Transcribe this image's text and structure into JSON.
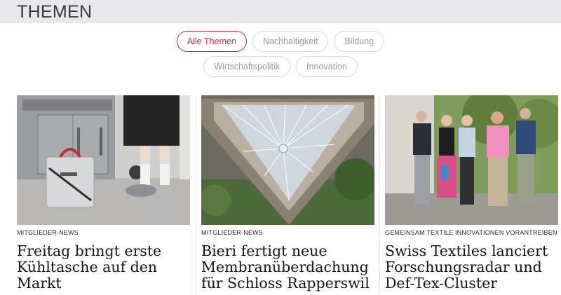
{
  "header": {
    "title": "THEMEN"
  },
  "filters": {
    "row1": [
      {
        "label": "Alle Themen",
        "active": true
      },
      {
        "label": "Nachhaltigkeit",
        "active": false
      },
      {
        "label": "Bildung",
        "active": false
      }
    ],
    "row2": [
      {
        "label": "Wirtschaftspolitik",
        "active": false
      },
      {
        "label": "Innovation",
        "active": false
      }
    ]
  },
  "articles": [
    {
      "category": "MITGLIEDER-NEWS",
      "title": "Freitag bringt erste Kühltasche auf den Markt"
    },
    {
      "category": "MITGLIEDER-NEWS",
      "title": "Bieri fertigt neue Membranüberdachung für Schloss Rapperswil"
    },
    {
      "category": "GEMEINSAM TEXTILE INNOVATIONEN VORANTREIBEN",
      "title": "Swiss Textiles lanciert Forschungsradar und Def-Tex-Cluster"
    }
  ],
  "colors": {
    "accent": "#c8323c",
    "header_bg": "#e8e7ec"
  }
}
